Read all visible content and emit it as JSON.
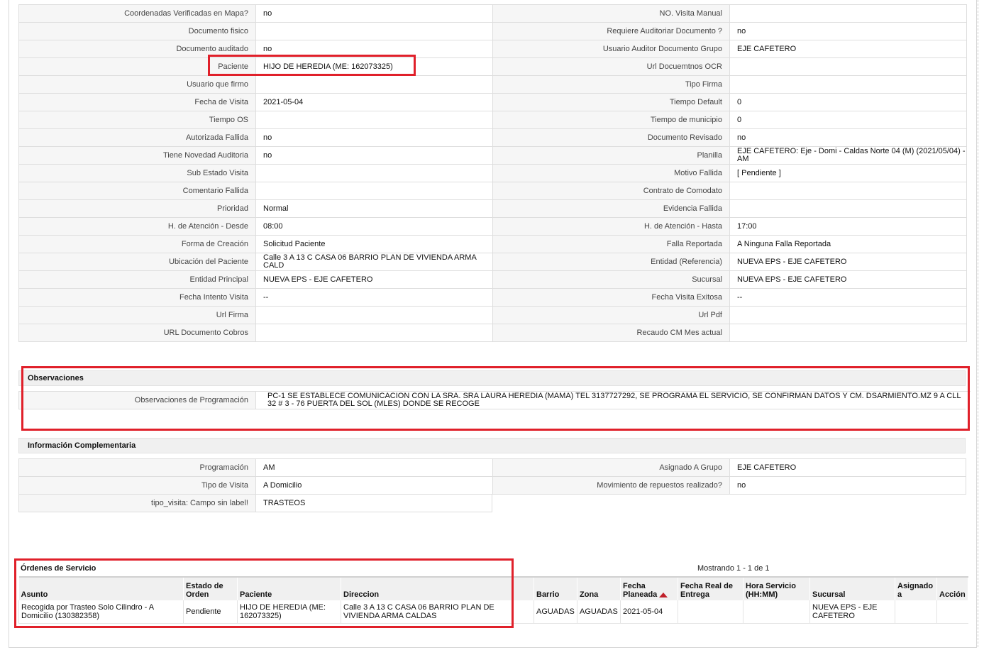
{
  "details": [
    [
      "Coordenadas Verificadas en Mapa?",
      "no",
      "NO. Visita Manual",
      ""
    ],
    [
      "Documento fisico",
      "",
      "Requiere Auditoriar Documento ?",
      "no"
    ],
    [
      "Documento auditado",
      "no",
      "Usuario Auditor Documento Grupo",
      "EJE CAFETERO"
    ],
    [
      "Paciente",
      "HIJO DE HEREDIA (ME: 162073325)",
      "Url Docuemtnos OCR",
      ""
    ],
    [
      "Usuario que firmo",
      "",
      "Tipo Firma",
      ""
    ],
    [
      "Fecha de Visita",
      "2021-05-04",
      "Tiempo Default",
      "0"
    ],
    [
      "Tiempo OS",
      "",
      "Tiempo de municipio",
      "0"
    ],
    [
      "Autorizada Fallida",
      "no",
      "Documento Revisado",
      "no"
    ],
    [
      "Tiene Novedad Auditoria",
      "no",
      "Planilla",
      "EJE CAFETERO: Eje - Domi - Caldas Norte 04 (M) (2021/05/04) - AM"
    ],
    [
      "Sub Estado Visita",
      "",
      "Motivo Fallida",
      "[ Pendiente ]"
    ],
    [
      "Comentario Fallida",
      "",
      "Contrato de Comodato",
      ""
    ],
    [
      "Prioridad",
      "Normal",
      "Evidencia Fallida",
      ""
    ],
    [
      "H. de Atención - Desde",
      "08:00",
      "H. de Atención - Hasta",
      "17:00"
    ],
    [
      "Forma de Creación",
      "Solicitud Paciente",
      "Falla Reportada",
      "A Ninguna Falla Reportada"
    ],
    [
      "Ubicación del Paciente",
      "Calle 3 A 13 C CASA 06 BARRIO PLAN DE VIVIENDA ARMA CALD",
      "Entidad (Referencia)",
      "NUEVA EPS - EJE CAFETERO"
    ],
    [
      "Entidad Principal",
      "NUEVA EPS - EJE CAFETERO",
      "Sucursal",
      "NUEVA EPS - EJE CAFETERO"
    ],
    [
      "Fecha Intento Visita",
      "--",
      "Fecha Visita Exitosa",
      "--"
    ],
    [
      "Url Firma",
      "",
      "Url Pdf",
      ""
    ],
    [
      "URL Documento Cobros",
      "",
      "Recaudo CM Mes actual",
      ""
    ]
  ],
  "observaciones": {
    "title": "Observaciones",
    "label": "Observaciones de Programación",
    "value": "PC-1 SE ESTABLECE COMUNICACION CON LA SRA. SRA LAURA HEREDIA (MAMA) TEL 3137727292, SE PROGRAMA EL SERVICIO, SE CONFIRMAN DATOS Y CM. DSARMIENTO.MZ 9 A CLL 32 # 3 - 76 PUERTA DEL SOL (MLES) DONDE SE RECOGE"
  },
  "complementaria": {
    "title": "Información Complementaria",
    "rows": [
      [
        "Programación",
        "AM",
        "Asignado A Grupo",
        "EJE CAFETERO"
      ],
      [
        "Tipo de Visita",
        "A Domicilio",
        "Movimiento de repuestos realizado?",
        "no"
      ],
      [
        "tipo_visita: Campo sin label!",
        "TRASTEOS"
      ]
    ]
  },
  "ordenes": {
    "title": "Órdenes de Servicio",
    "paging": "Mostrando 1 - 1 de 1",
    "headers": [
      "Asunto",
      "Estado de Orden",
      "Paciente",
      "Direccion",
      "",
      "Barrio",
      "Zona",
      "Fecha Planeada",
      "Fecha Real de Entrega",
      "Hora Servicio (HH:MM)",
      "Sucursal",
      "Asignado a",
      "Acción"
    ],
    "rows": [
      [
        "Recogida por Trasteo Solo Cilindro - A Domicilio (130382358)",
        "Pendiente",
        "HIJO DE HEREDIA (ME: 162073325)",
        "Calle 3 A 13 C CASA 06 BARRIO PLAN DE VIVIENDA ARMA CALDAS",
        "",
        "AGUADAS",
        "AGUADAS",
        "2021-05-04",
        "",
        "",
        "NUEVA EPS - EJE CAFETERO",
        "",
        ""
      ]
    ]
  },
  "colors": {
    "highlight": "#e0202a",
    "label_bg": "#f6f6f6",
    "header_bg": "#f0f0f0",
    "sort_icon": "#c0202a"
  }
}
